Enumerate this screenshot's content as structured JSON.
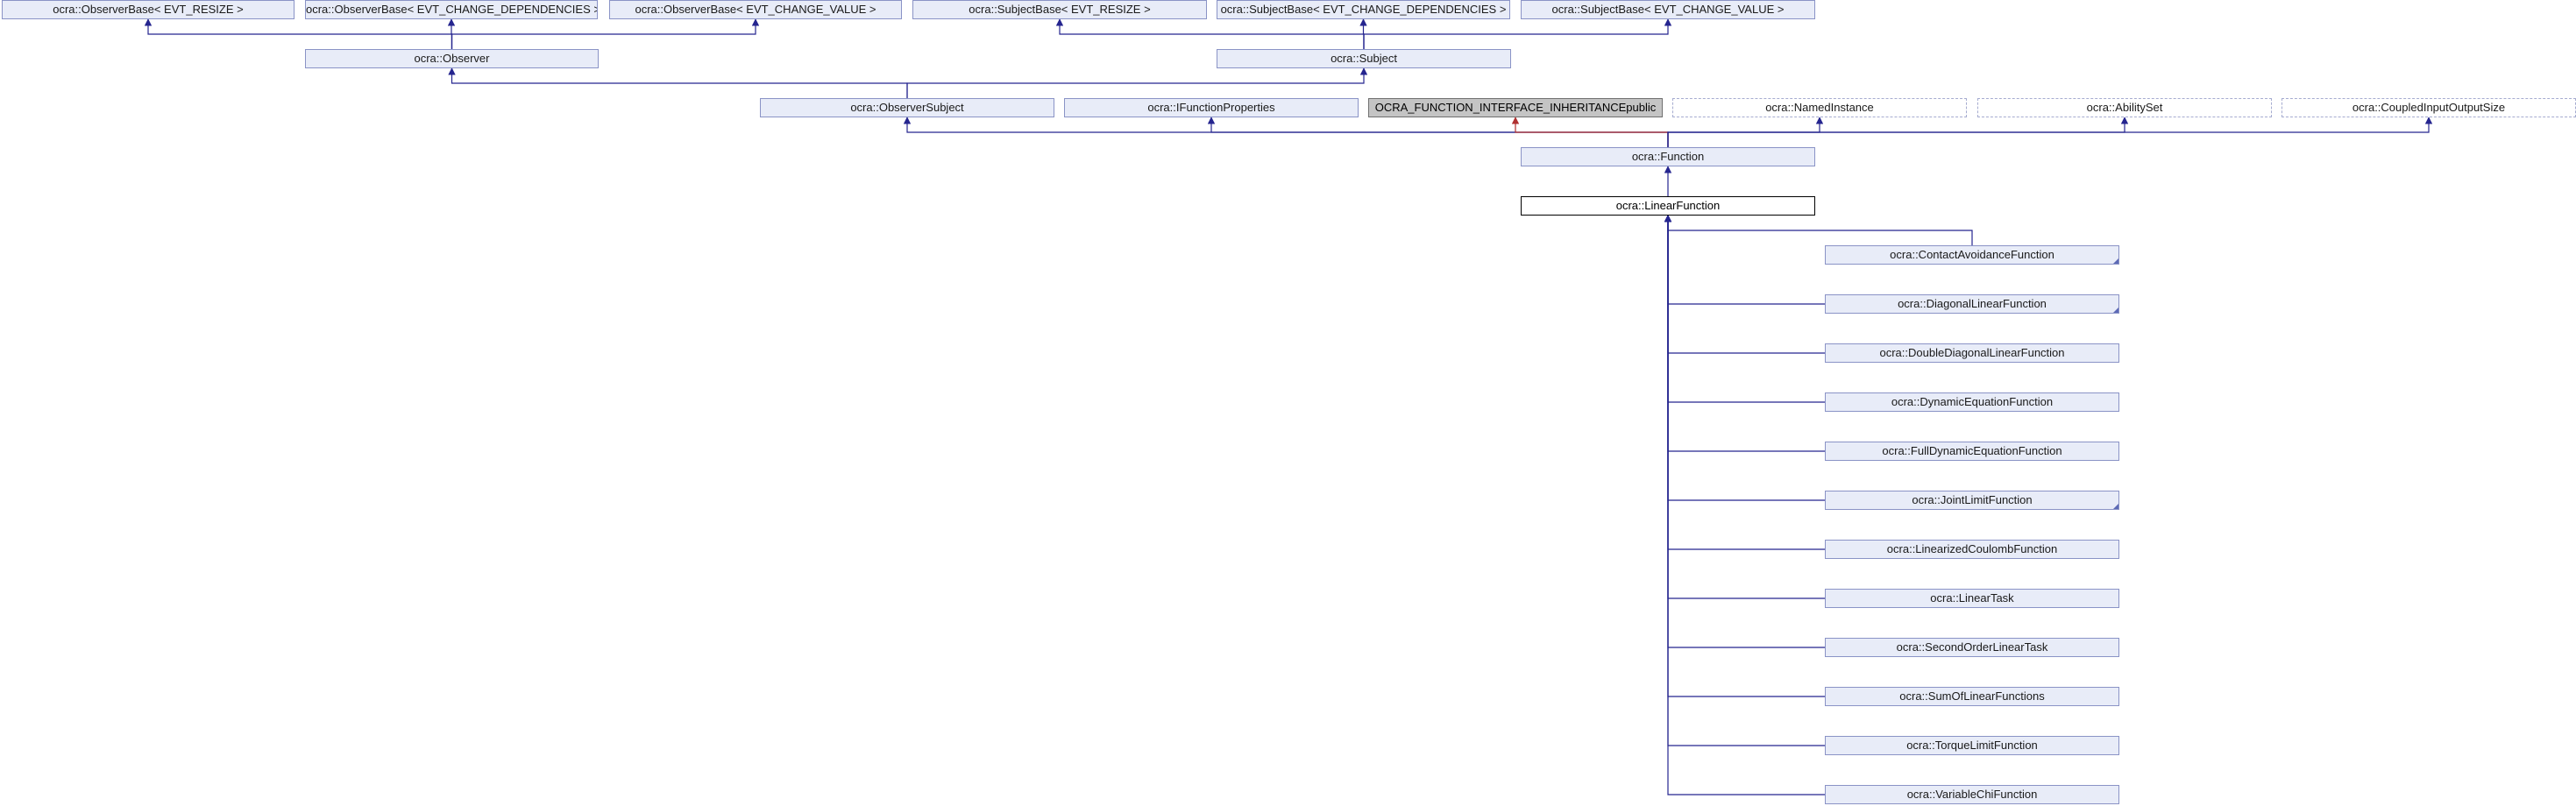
{
  "diagram": {
    "nodes": {
      "observer_base_resize": "ocra::ObserverBase< EVT_RESIZE >",
      "observer_base_change_dependencies": "ocra::ObserverBase< EVT_CHANGE_DEPENDENCIES >",
      "observer_base_change_value": "ocra::ObserverBase< EVT_CHANGE_VALUE >",
      "subject_base_resize": "ocra::SubjectBase< EVT_RESIZE >",
      "subject_base_change_dependencies": "ocra::SubjectBase< EVT_CHANGE_DEPENDENCIES >",
      "subject_base_change_value": "ocra::SubjectBase< EVT_CHANGE_VALUE >",
      "observer": "ocra::Observer",
      "subject": "ocra::Subject",
      "observer_subject": "ocra::ObserverSubject",
      "ifunction_properties": "ocra::IFunctionProperties",
      "ocra_function_interface_inheritance": "OCRA_FUNCTION_INTERFACE_INHERITANCEpublic",
      "named_instance": "ocra::NamedInstance",
      "ability_set": "ocra::AbilitySet",
      "coupled_input_output_size": "ocra::CoupledInputOutputSize",
      "function": "ocra::Function",
      "linear_function": "ocra::LinearFunction",
      "contact_avoidance_function": "ocra::ContactAvoidanceFunction",
      "diagonal_linear_function": "ocra::DiagonalLinearFunction",
      "double_diagonal_linear_function": "ocra::DoubleDiagonalLinearFunction",
      "dynamic_equation_function": "ocra::DynamicEquationFunction",
      "full_dynamic_equation_function": "ocra::FullDynamicEquationFunction",
      "joint_limit_function": "ocra::JointLimitFunction",
      "linearized_coulomb_function": "ocra::LinearizedCoulombFunction",
      "linear_task": "ocra::LinearTask",
      "second_order_linear_task": "ocra::SecondOrderLinearTask",
      "sum_of_linear_functions": "ocra::SumOfLinearFunctions",
      "torque_limit_function": "ocra::TorqueLimitFunction",
      "variable_chi_function": "ocra::VariableChiFunction"
    },
    "edges": [
      [
        "observer",
        "observer_base_resize"
      ],
      [
        "observer",
        "observer_base_change_dependencies"
      ],
      [
        "observer",
        "observer_base_change_value"
      ],
      [
        "subject",
        "subject_base_resize"
      ],
      [
        "subject",
        "subject_base_change_dependencies"
      ],
      [
        "subject",
        "subject_base_change_value"
      ],
      [
        "observer_subject",
        "observer"
      ],
      [
        "observer_subject",
        "subject"
      ],
      [
        "function",
        "observer_subject"
      ],
      [
        "function",
        "ifunction_properties"
      ],
      [
        "function",
        "ocra_function_interface_inheritance"
      ],
      [
        "function",
        "named_instance"
      ],
      [
        "function",
        "ability_set"
      ],
      [
        "function",
        "coupled_input_output_size"
      ],
      [
        "linear_function",
        "function"
      ],
      [
        "contact_avoidance_function",
        "linear_function"
      ],
      [
        "diagonal_linear_function",
        "linear_function"
      ],
      [
        "double_diagonal_linear_function",
        "linear_function"
      ],
      [
        "dynamic_equation_function",
        "linear_function"
      ],
      [
        "full_dynamic_equation_function",
        "linear_function"
      ],
      [
        "joint_limit_function",
        "linear_function"
      ],
      [
        "linearized_coulomb_function",
        "linear_function"
      ],
      [
        "linear_task",
        "linear_function"
      ],
      [
        "second_order_linear_task",
        "linear_function"
      ],
      [
        "sum_of_linear_functions",
        "linear_function"
      ],
      [
        "torque_limit_function",
        "linear_function"
      ],
      [
        "variable_chi_function",
        "linear_function"
      ]
    ],
    "colors": {
      "edge": "#25258f",
      "hidden_edge": "#b03030",
      "node_fill": "#e8ecf8",
      "node_border": "#8a93c6"
    }
  }
}
